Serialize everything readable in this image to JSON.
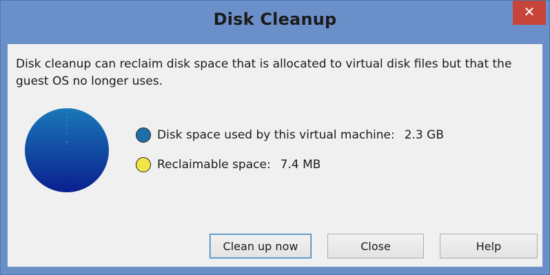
{
  "window": {
    "title": "Disk Cleanup",
    "close_glyph": "✕"
  },
  "message": "Disk cleanup can reclaim disk space that is allocated to virtual disk files but that the guest OS no longer uses.",
  "legend": [
    {
      "label": "Disk space used by this virtual machine:",
      "value": "2.3 GB",
      "color": "#1e6fa8"
    },
    {
      "label": "Reclaimable space:",
      "value": "7.4 MB",
      "color": "#f2e547"
    }
  ],
  "pie": {
    "used_gb": 2.3,
    "reclaimable_mb": 7.4,
    "gradient_top": "#1a78b8",
    "gradient_bottom": "#0a1f8f"
  },
  "buttons": {
    "cleanup": "Clean up now",
    "close": "Close",
    "help": "Help"
  }
}
